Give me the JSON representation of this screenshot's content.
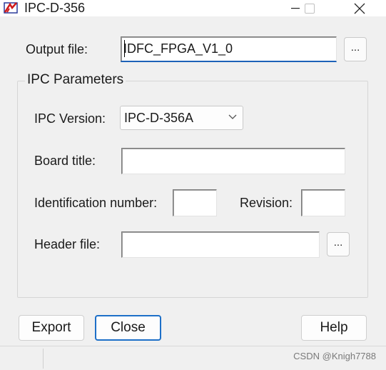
{
  "window": {
    "title": "IPC-D-356"
  },
  "output": {
    "label": "Output file:",
    "value": "IDFC_FPGA_V1_0",
    "browse_label": "..."
  },
  "group": {
    "title": "IPC Parameters"
  },
  "ipc_version": {
    "label": "IPC Version:",
    "selected": "IPC-D-356A"
  },
  "board_title": {
    "label": "Board title:",
    "value": ""
  },
  "identification": {
    "label": "Identification number:",
    "value": ""
  },
  "revision": {
    "label": "Revision:",
    "value": ""
  },
  "header_file": {
    "label": "Header file:",
    "value": "",
    "browse_label": "..."
  },
  "buttons": {
    "export": "Export",
    "close": "Close",
    "help": "Help"
  },
  "statusbar": {
    "watermark": "CSDN @Knigh7788"
  },
  "colors": {
    "accent": "#1d6fc8",
    "background": "#f0f0f0"
  }
}
